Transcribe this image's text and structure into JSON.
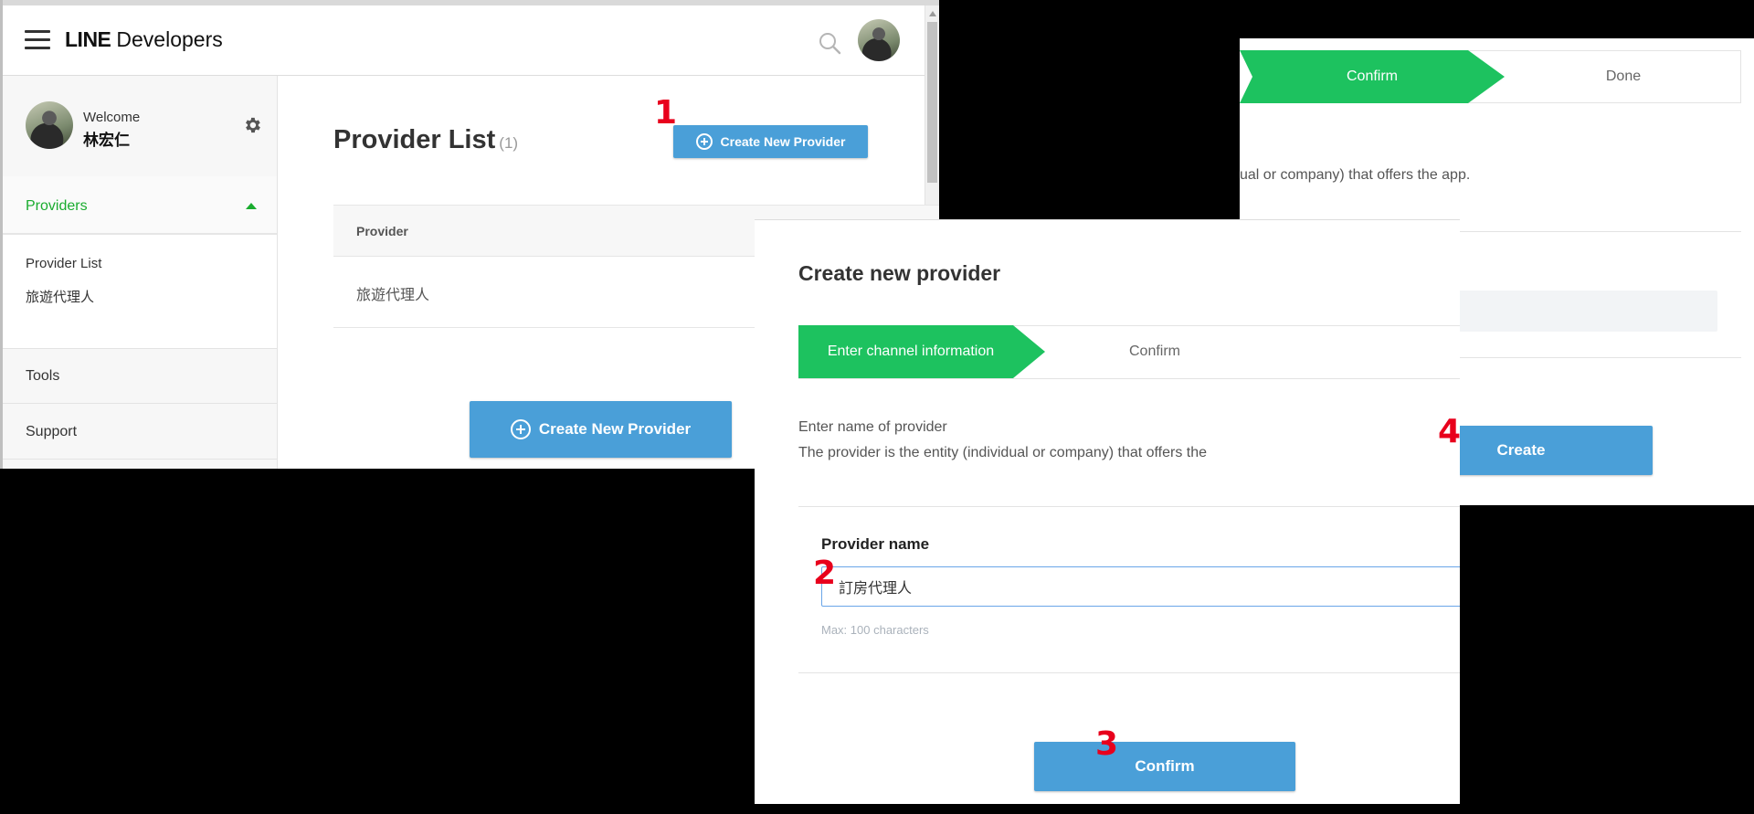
{
  "console": {
    "brand_line": "LINE",
    "brand_product": "Developers",
    "welcome_label": "Welcome",
    "user_name": "林宏仁",
    "nav_providers": "Providers",
    "subnav": [
      "Provider List",
      "旅遊代理人"
    ],
    "nav_tools": "Tools",
    "nav_support": "Support",
    "page_title": "Provider List",
    "provider_count": "(1)",
    "create_button_top": "Create New Provider",
    "create_button_bottom": "Create New Provider",
    "table_header": "Provider",
    "table_rows": [
      "旅遊代理人"
    ]
  },
  "dialog": {
    "title": "Create new provider",
    "step_active": "Enter channel information",
    "step_next": "Confirm",
    "instruction_line1": "Enter name of provider",
    "instruction_line2": "The provider is the entity (individual or company) that offers the",
    "field_label": "Provider name",
    "field_value": "訂房代理人",
    "field_hint": "Max: 100 characters",
    "confirm_button": "Confirm"
  },
  "confirm_panel": {
    "step_active": "Confirm",
    "step_next": "Done",
    "description_fragment": "ual or company) that offers the app.",
    "create_button": "Create"
  },
  "markers": {
    "m1": "1",
    "m2": "2",
    "m3": "3",
    "m4": "4"
  },
  "colors": {
    "accent_green": "#1dc25f",
    "nav_green": "#1aac2f",
    "button_blue": "#4a9fd8",
    "marker_red": "#e8001c"
  },
  "icons": [
    "menu-icon",
    "search-icon",
    "gear-icon",
    "caret-up-icon",
    "plus-circle-icon"
  ]
}
